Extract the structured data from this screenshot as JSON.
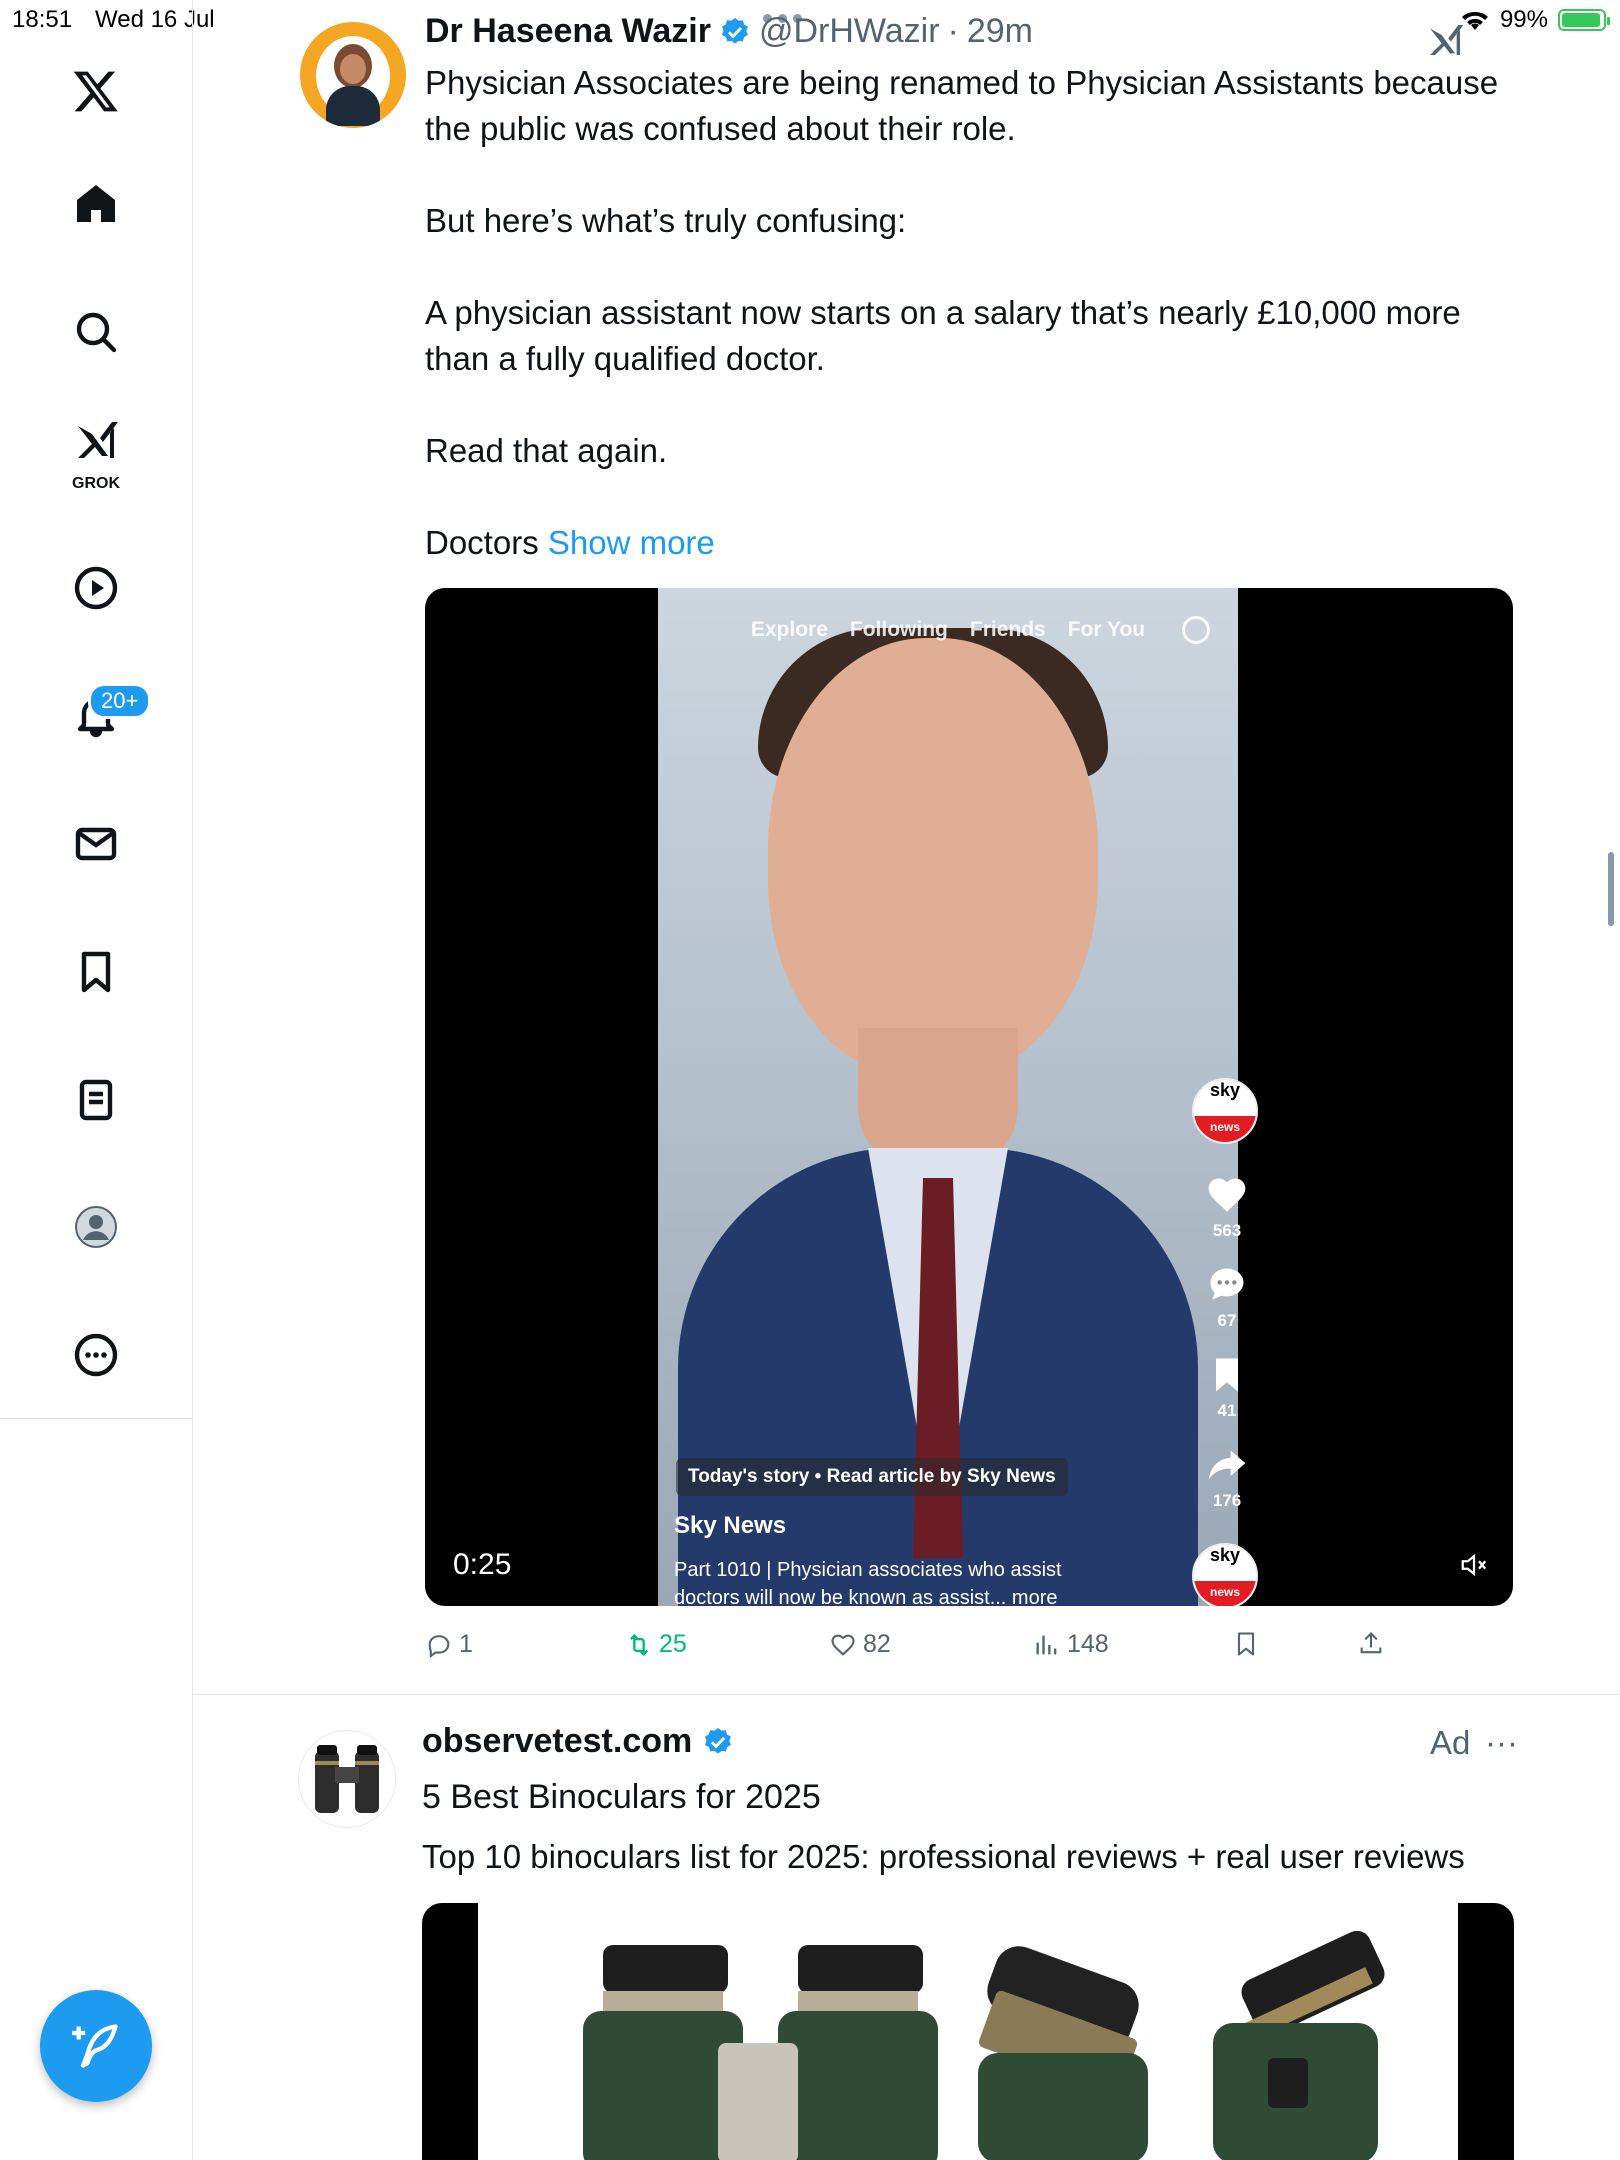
{
  "status_bar": {
    "time": "18:51",
    "date": "Wed 16 Jul",
    "battery": "99%"
  },
  "sidebar": {
    "grok_label": "GROK",
    "notifications_badge": "20+"
  },
  "tweet": {
    "author_name": "Dr Haseena Wazir",
    "handle": "@DrHWazir",
    "separator": "·",
    "time": "29m",
    "paragraphs": [
      "Physician Associates are being renamed to Physician Assistants because the public was confused about their role.",
      "But here’s what’s truly confusing:",
      "A physician assistant now starts on a salary that’s nearly £10,000 more than a fully qualified doctor.",
      "Read that again."
    ],
    "last_line": "Doctors",
    "show_more": "Show more",
    "video": {
      "nav": [
        "Explore",
        "Following",
        "Friends",
        "For You"
      ],
      "likes": "563",
      "comments": "67",
      "bookmarks": "41",
      "shares": "176",
      "logo_text": "sky",
      "logo_sub": "news",
      "story": "Today's story • Read article by Sky News",
      "account": "Sky News",
      "description": "Part 1010 | Physician associates who assist doctors will now be known as assist... more",
      "elapsed": "0:25"
    },
    "stats": {
      "replies": "1",
      "reposts": "25",
      "likes": "82",
      "views": "148"
    }
  },
  "ad": {
    "advertiser": "observetest.com",
    "tag": "Ad",
    "headline": "5 Best Binoculars for 2025",
    "body": "Top 10 binoculars list for 2025: professional reviews + real user reviews"
  }
}
